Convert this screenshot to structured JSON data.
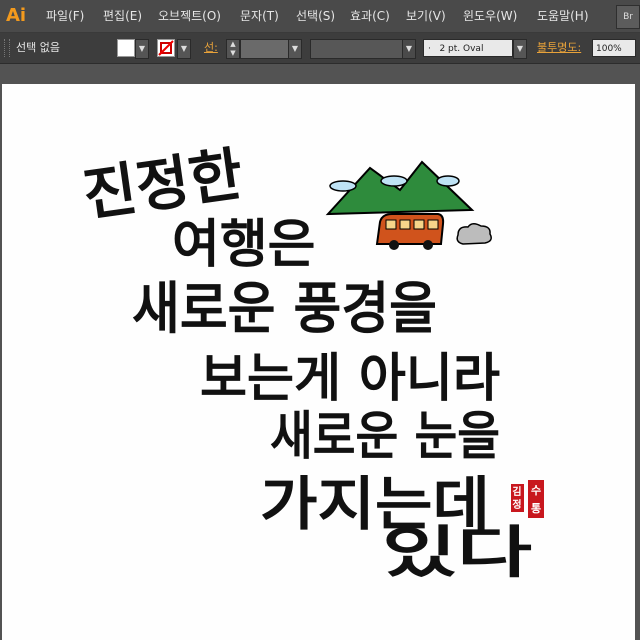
{
  "app": {
    "logo": "Ai"
  },
  "menu": [
    {
      "label": "파일(F)"
    },
    {
      "label": "편집(E)"
    },
    {
      "label": "오브젝트(O)"
    },
    {
      "label": "문자(T)"
    },
    {
      "label": "선택(S)"
    },
    {
      "label": "효과(C)"
    },
    {
      "label": "보기(V)"
    },
    {
      "label": "윈도우(W)"
    },
    {
      "label": "도움말(H)"
    }
  ],
  "bridge_button": "Br",
  "control": {
    "selection": "선택 없음",
    "stroke_label": "선:",
    "brush": "2 pt. Oval",
    "brush_prefix": "·",
    "opacity_label": "불투명도:",
    "opacity": "100%"
  },
  "artwork": {
    "lines": [
      "진정한",
      "여행은",
      "새로운 풍경을",
      "보는게 아니라",
      "새로운 눈을",
      "가지는데",
      "있다"
    ],
    "seal": [
      "김",
      "정",
      "수",
      "통"
    ]
  },
  "colors": {
    "menubar": "#4a4a4a",
    "accent": "#e8a23a",
    "logo": "#f39a1d",
    "mountain": "#2e8b3c",
    "bus": "#d0531c",
    "seal": "#c8171e",
    "ink": "#111111"
  }
}
